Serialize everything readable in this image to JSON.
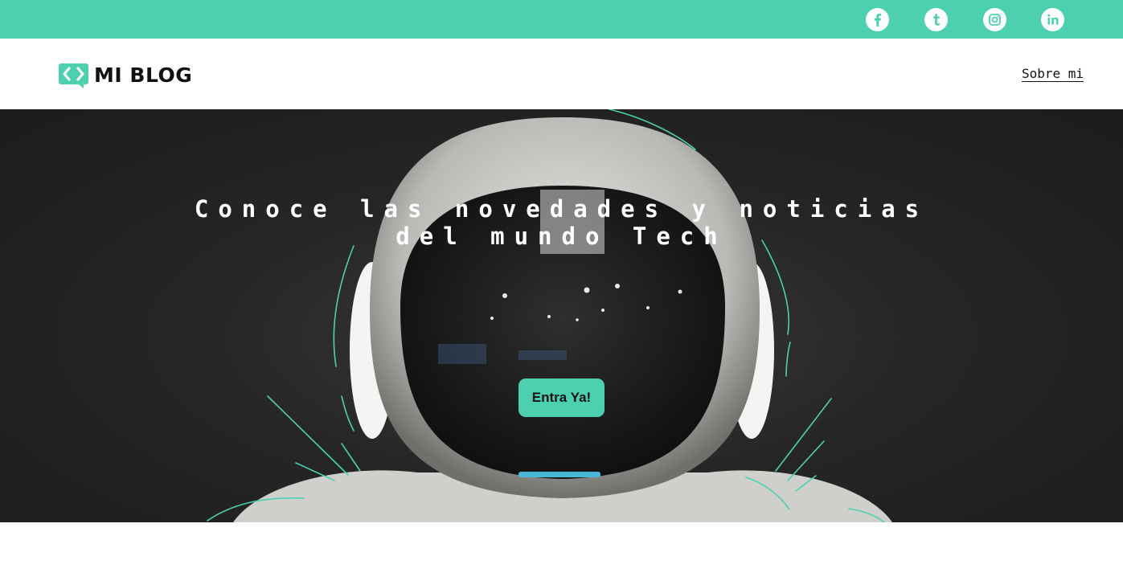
{
  "brand": {
    "name": "MI BLOG",
    "accent": "#4dd0b0"
  },
  "social": [
    {
      "icon": "facebook-icon"
    },
    {
      "icon": "tumblr-icon"
    },
    {
      "icon": "instagram-icon"
    },
    {
      "icon": "linkedin-icon"
    }
  ],
  "nav": {
    "about_label": "Sobre mi"
  },
  "hero": {
    "title": "Conoce las novedades y noticias del mundo Tech",
    "cta_label": "Entra Ya!"
  }
}
